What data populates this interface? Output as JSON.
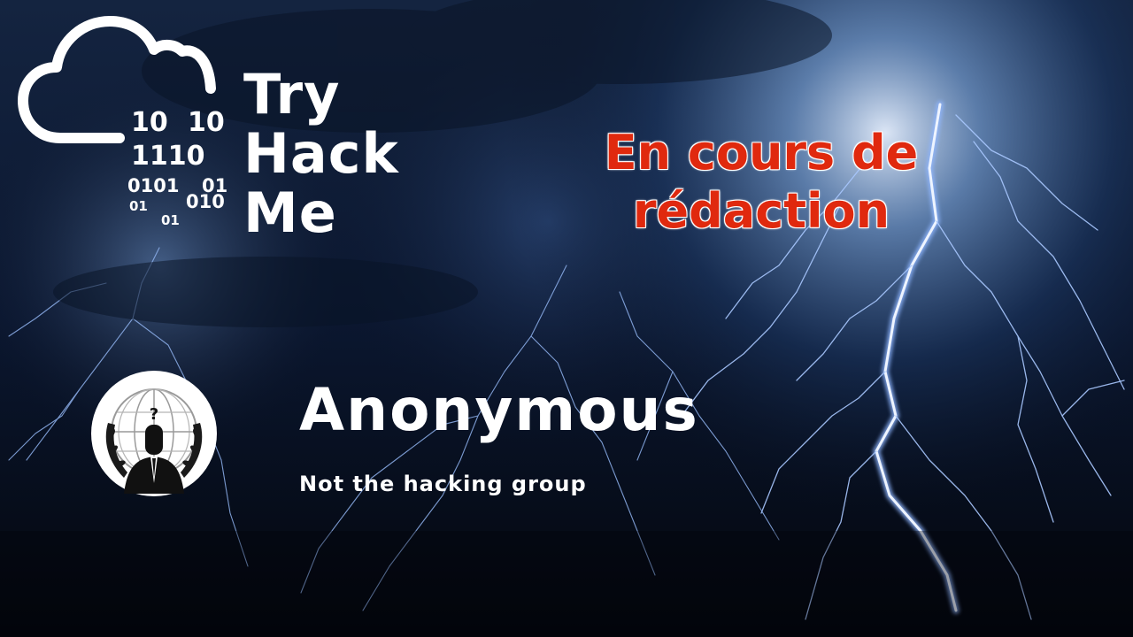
{
  "logo": {
    "binary_rows": [
      "10",
      "10",
      "1110",
      "0101",
      "01",
      "01",
      "010",
      "01"
    ],
    "brand_lines": [
      "Try",
      "Hack",
      "Me"
    ]
  },
  "banner": {
    "status_lines": [
      "En cours de",
      "rédaction"
    ]
  },
  "profile": {
    "name": "Anonymous",
    "tagline": "Not the hacking group"
  },
  "colors": {
    "status_red": "#e0290e",
    "text_white": "#ffffff",
    "sky_dark": "#050a14",
    "lightning_blue": "#9fc4ff"
  },
  "icons": {
    "logo": "cloud-icon",
    "emblem": "anonymous-emblem-icon"
  }
}
